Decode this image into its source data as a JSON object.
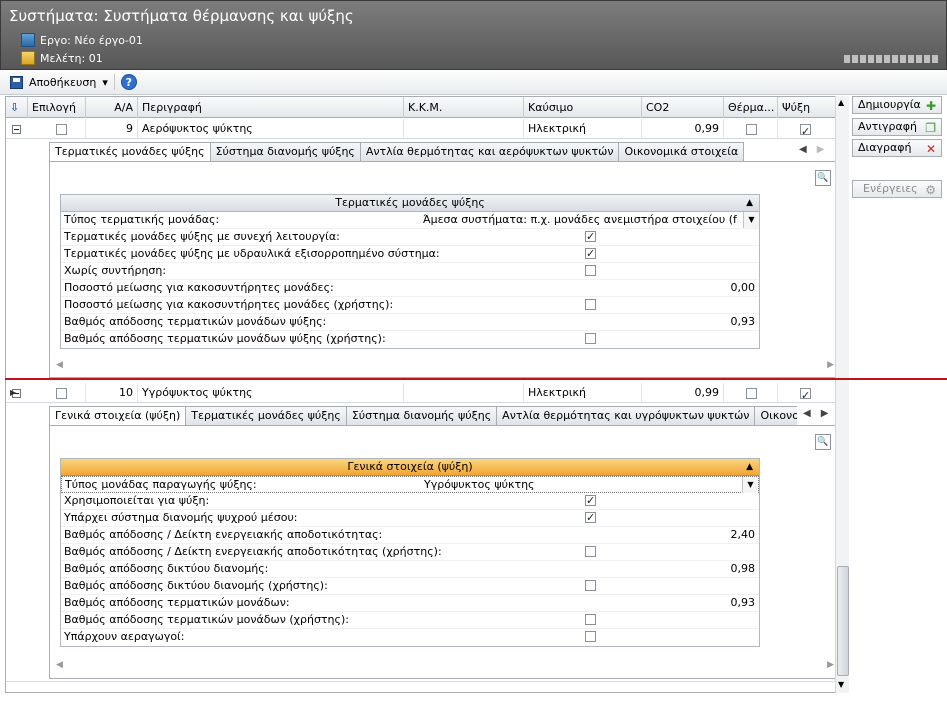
{
  "window": {
    "title": "Συστήματα: Συστήματα θέρμανσης και ψύξης",
    "project_label": "Εργο: Νέο έργο-01",
    "study_label": "Μελέτη: 01"
  },
  "toolbar": {
    "save_label": "Αποθήκευση",
    "dropdown_glyph": "▾",
    "help_glyph": "?"
  },
  "grid": {
    "columns": [
      "Επιλογή",
      "Α/Α",
      "Περιγραφή",
      "Κ.Κ.Μ.",
      "Καύσιμο",
      "CO2",
      "Θέρμα...",
      "Ψύξη"
    ],
    "sort_glyph": "⇩",
    "rows": [
      {
        "aa": "9",
        "description": "Αερόψυκτος ψύκτης",
        "kkm": "",
        "fuel": "Ηλεκτρική",
        "co2": "0,99",
        "heating": false,
        "cooling": true,
        "tabs": [
          "Τερματικές μονάδες ψύξης",
          "Σύστημα διανομής ψύξης",
          "Αντλία θερμότητας και αερόψυκτων ψυκτών",
          "Οικονομικά στοιχεία"
        ],
        "active_tab": 0,
        "panel_title": "Τερματικές μονάδες ψύξης",
        "props": [
          {
            "label": "Τύπος τερματικής μονάδας:",
            "value": "Άμεσα συστήματα: π.χ. μονάδες ανεμιστήρα στοιχείου (fa..."
          },
          {
            "label": "Τερματικές μονάδες ψύξης με συνεχή λειτουργία:",
            "checked": true
          },
          {
            "label": "Τερματικές μονάδες ψύξης με υδραυλικά εξισορροπημένο σύστημα:",
            "checked": true
          },
          {
            "label": "Χωρίς συντήρηση:",
            "checked": false
          },
          {
            "label": "Ποσοστό μείωσης για κακοσυντήρητες μονάδες:",
            "number": "0,00"
          },
          {
            "label": "Ποσοστό μείωσης για κακοσυντήρητες μονάδες (χρήστης):",
            "checked": false
          },
          {
            "label": "Βαθμός απόδοσης τερματικών μονάδων ψύξης:",
            "number": "0,93"
          },
          {
            "label": "Βαθμός απόδοσης τερματικών μονάδων ψύξης (χρήστης):",
            "checked": false
          }
        ]
      },
      {
        "aa": "10",
        "description": "Υγρόψυκτος ψύκτης",
        "kkm": "",
        "fuel": "Ηλεκτρική",
        "co2": "0,99",
        "heating": false,
        "cooling": true,
        "tabs": [
          "Γενικά στοιχεία (ψύξη)",
          "Τερματικές μονάδες ψύξης",
          "Σύστημα διανομής ψύξης",
          "Αντλία θερμότητας και υγρόψυκτων ψυκτών",
          "Οικονομικά σ"
        ],
        "active_tab": 0,
        "panel_title": "Γενικά στοιχεία (ψύξη)",
        "props": [
          {
            "label": "Τύπος μονάδας παραγωγής ψύξης:",
            "value": "Υγρόψυκτος ψύκτης"
          },
          {
            "label": "Χρησιμοποιείται για ψύξη:",
            "checked": true
          },
          {
            "label": "Υπάρχει σύστημα διανομής ψυχρού μέσου:",
            "checked": true
          },
          {
            "label": "Βαθμός απόδοσης / Δείκτη ενεργειακής αποδοτικότητας:",
            "number": "2,40"
          },
          {
            "label": "Βαθμός απόδοσης / Δείκτη ενεργειακής αποδοτικότητας (χρήστης):",
            "checked": false
          },
          {
            "label": "Βαθμός απόδοσης δικτύου διανομής:",
            "number": "0,98"
          },
          {
            "label": "Βαθμός απόδοσης δικτύου διανομής (χρήστης):",
            "checked": false
          },
          {
            "label": "Βαθμός απόδοσης τερματικών μονάδων:",
            "number": "0,93"
          },
          {
            "label": "Βαθμός απόδοσης τερματικών μονάδων (χρήστης):",
            "checked": false
          },
          {
            "label": "Υπάρχουν αεραγωγοί:",
            "checked": false
          }
        ]
      }
    ]
  },
  "side_buttons": [
    {
      "label": "Δημιουργία",
      "icon": "add-icon",
      "glyph": "✚",
      "color": "#3a9a2a"
    },
    {
      "label": "Αντιγραφή",
      "icon": "copy-icon",
      "glyph": "❐",
      "color": "#3a9a2a"
    },
    {
      "label": "Διαγραφή",
      "icon": "delete-icon",
      "glyph": "✕",
      "color": "#d41f1f"
    },
    {
      "label": "Ενέργειες",
      "icon": "gears-icon",
      "glyph": "⚙",
      "color": "#9a9a9a",
      "disabled": true
    }
  ],
  "colors": {
    "accent_orange": "#f2a535",
    "divider_red": "#c2111d"
  }
}
